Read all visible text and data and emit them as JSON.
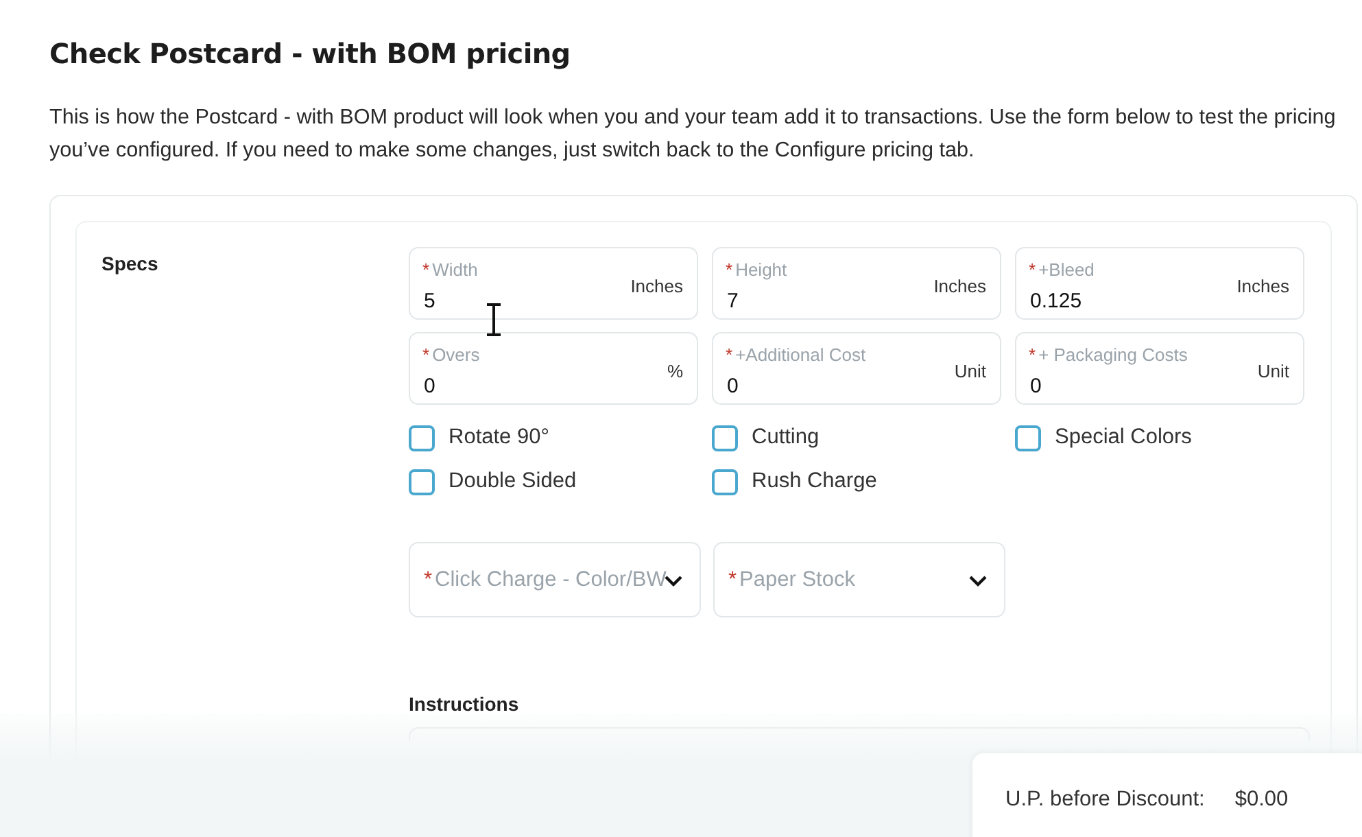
{
  "title": "Check Postcard - with BOM pricing",
  "description": "This is how the Postcard - with BOM product will look when you and your team add it to transactions. Use the form below to test the pricing you’ve configured. If you need to make some changes, just switch back to the Configure pricing tab.",
  "section": {
    "label": "Specs",
    "fields": [
      {
        "kind": "input",
        "required_mark": "*",
        "label": "Width",
        "value": "5",
        "unit": "Inches"
      },
      {
        "kind": "input",
        "required_mark": "*",
        "label": "Height",
        "value": "7",
        "unit": "Inches"
      },
      {
        "kind": "input",
        "required_mark": "*",
        "label": "+Bleed",
        "value": "0.125",
        "unit": "Inches"
      },
      {
        "kind": "input",
        "required_mark": "*",
        "label": "Overs",
        "value": "0",
        "unit": "%"
      },
      {
        "kind": "input",
        "required_mark": "*",
        "label": "+Additional Cost",
        "value": "0",
        "unit": "Unit"
      },
      {
        "kind": "input",
        "required_mark": "*",
        "label": "+ Packaging Costs",
        "value": "0",
        "unit": "Unit"
      }
    ],
    "checkboxes": [
      {
        "label": "Rotate 90°",
        "checked": false
      },
      {
        "label": "Cutting",
        "checked": false
      },
      {
        "label": "Special Colors",
        "checked": false
      },
      {
        "label": "Double Sided",
        "checked": false
      },
      {
        "label": "Rush Charge",
        "checked": false
      }
    ],
    "selects": [
      {
        "required_mark": "*",
        "placeholder": "Click Charge - Color/BW"
      },
      {
        "required_mark": "*",
        "placeholder": "Paper Stock"
      }
    ],
    "instructions_label": "Instructions"
  },
  "price": {
    "label": "U.P. before Discount:",
    "value": "$0.00"
  }
}
